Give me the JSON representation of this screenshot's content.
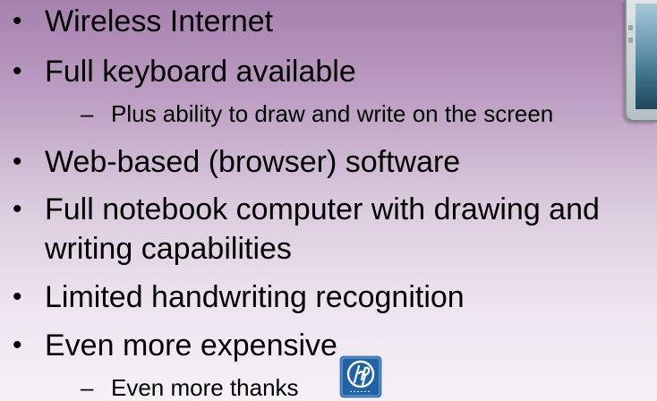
{
  "slide": {
    "bullets": [
      {
        "text": "Wireless Internet"
      },
      {
        "text": "Full keyboard available"
      },
      {
        "text": "Web-based (browser) software"
      },
      {
        "text": "Full notebook computer with drawing and"
      },
      {
        "text": "writing capabilities"
      },
      {
        "text": "Limited handwriting recognition"
      },
      {
        "text": "Even more expensive"
      }
    ],
    "sub_bullets": [
      {
        "text": "Plus ability to draw and write on the screen"
      },
      {
        "text": "Even more thanks"
      }
    ],
    "bullet_symbol": "•",
    "dash_symbol": "–",
    "logo": {
      "brand": "hp",
      "tagline": "invent",
      "color": "#1f63a6"
    }
  }
}
